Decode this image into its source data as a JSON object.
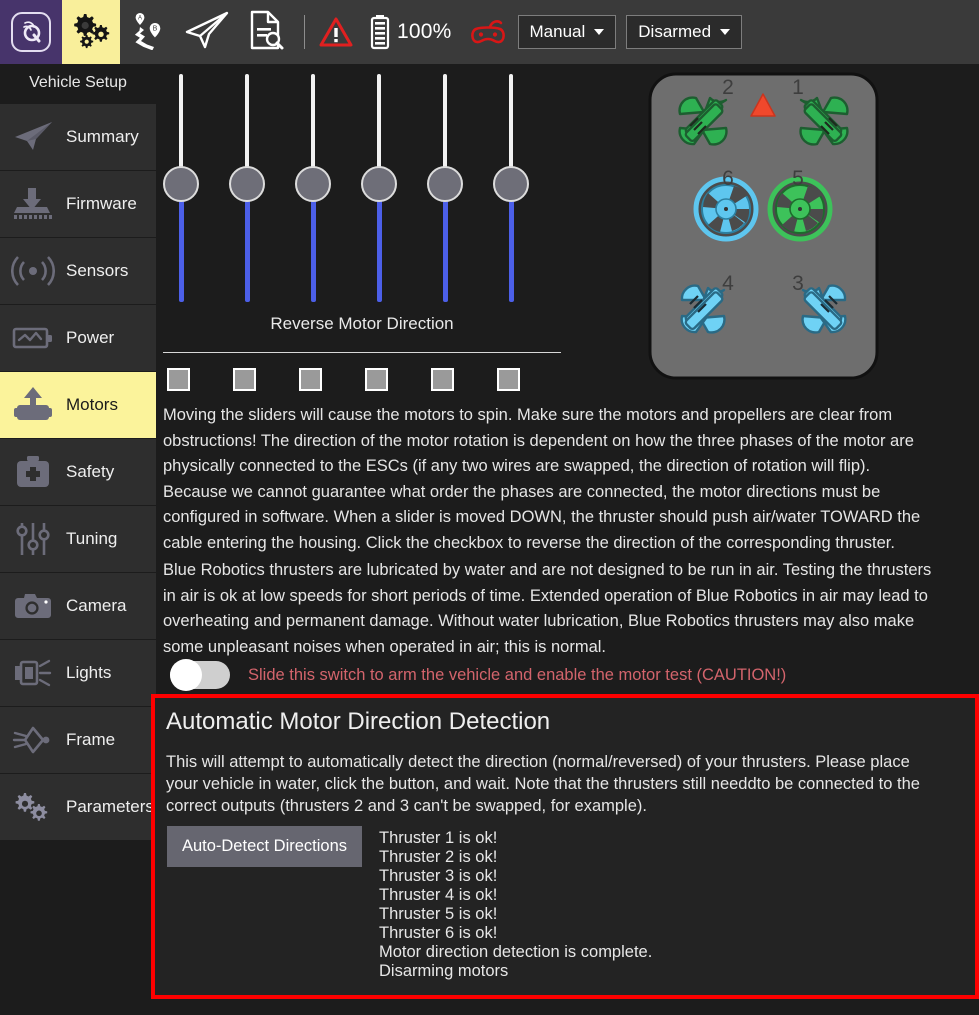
{
  "toolbar": {
    "logo_icon": "qgc-logo-icon",
    "items": [
      {
        "icon": "gears-icon",
        "name": "vehicle-setup",
        "active": true
      },
      {
        "icon": "plan-route-icon",
        "name": "plan",
        "active": false
      },
      {
        "icon": "paper-plane-icon",
        "name": "fly",
        "active": false
      },
      {
        "icon": "analyze-file-icon",
        "name": "analyze",
        "active": false
      }
    ],
    "warning_icon": "warning-triangle-icon",
    "battery_icon": "battery-full-icon",
    "battery_text": "100%",
    "rc_icon": "gamepad-icon",
    "flight_mode": "Manual",
    "arm_state": "Disarmed"
  },
  "sidebar": {
    "title": "Vehicle Setup",
    "items": [
      {
        "label": "Summary",
        "icon": "paper-plane-icon"
      },
      {
        "label": "Firmware",
        "icon": "firmware-download-icon"
      },
      {
        "label": "Sensors",
        "icon": "sensor-waves-icon"
      },
      {
        "label": "Power",
        "icon": "battery-power-icon"
      },
      {
        "label": "Motors",
        "icon": "motor-icon",
        "active": true
      },
      {
        "label": "Safety",
        "icon": "first-aid-kit-icon"
      },
      {
        "label": "Tuning",
        "icon": "sliders-icon"
      },
      {
        "label": "Camera",
        "icon": "camera-icon"
      },
      {
        "label": "Lights",
        "icon": "light-icon"
      },
      {
        "label": "Frame",
        "icon": "frame-icon"
      },
      {
        "label": "Parameters",
        "icon": "gears-icon"
      }
    ]
  },
  "motors": {
    "slider_count": 6,
    "slider_value_percent": 50,
    "reverse_label": "Reverse Motor Direction",
    "checkbox_count": 6,
    "checkboxes_checked": [
      false,
      false,
      false,
      false,
      false,
      false
    ]
  },
  "frame": {
    "heading_indicator": "red-triangle-icon",
    "thrusters": [
      {
        "id": "2",
        "type": "angled",
        "color": "#2eb152",
        "position": "front-left"
      },
      {
        "id": "1",
        "type": "angled",
        "color": "#2eb152",
        "position": "front-right"
      },
      {
        "id": "6",
        "type": "vertical",
        "color": "#5ec6ef",
        "position": "mid-left"
      },
      {
        "id": "5",
        "type": "vertical",
        "color": "#3dc25a",
        "position": "mid-right"
      },
      {
        "id": "4",
        "type": "angled",
        "color": "#6fd2f5",
        "position": "rear-left"
      },
      {
        "id": "3",
        "type": "angled",
        "color": "#6fd2f5",
        "position": "rear-right"
      }
    ],
    "body_color": "#6e6e6e"
  },
  "info": {
    "paragraph1": "Moving the sliders will cause the motors to spin. Make sure the motors and propellers are clear from obstructions! The direction of the motor rotation is dependent on how the three phases of the motor are physically connected to the ESCs (if any two wires are swapped, the direction of rotation will flip). Because we cannot guarantee what order the phases are connected, the motor directions must be configured in software. When a slider is moved DOWN, the thruster should push air/water TOWARD the cable entering the housing. Click the checkbox to reverse the direction of the corresponding thruster.",
    "paragraph2": "Blue Robotics thrusters are lubricated by water and are not designed to be run in air. Testing the thrusters in air is ok at low speeds for short periods of time. Extended operation of Blue Robotics in air may lead to overheating and permanent damage. Without water lubrication, Blue Robotics thrusters may also make some unpleasant noises when operated in air; this is normal."
  },
  "arm_switch": {
    "label": "Slide this switch to arm the vehicle and enable the motor test (CAUTION!)",
    "state": "off",
    "label_color": "#d3646c"
  },
  "auto_detect": {
    "title": "Automatic Motor Direction Detection",
    "description": "This will attempt to automatically detect the direction (normal/reversed) of your thrusters. Please place your vehicle in water, click the button, and wait. Note that the thrusters still needdto be connected to the correct outputs (thrusters 2 and 3 can't be swapped, for example).",
    "button_label": "Auto-Detect Directions",
    "log_lines": [
      "Thruster 1 is ok!",
      "Thruster 2 is ok!",
      "Thruster 3 is ok!",
      "Thruster 4 is ok!",
      "Thruster 5 is ok!",
      "Thruster 6 is ok!",
      "Motor direction detection is complete.",
      "Disarming motors"
    ],
    "border_color": "#fe0000"
  },
  "colors": {
    "accent_yellow": "#fbf39b",
    "toolbar_bg": "#3a3a3a",
    "page_bg": "#1c1c1c",
    "slider_blue": "#4c5fe8",
    "alert_red": "#fe0000"
  }
}
